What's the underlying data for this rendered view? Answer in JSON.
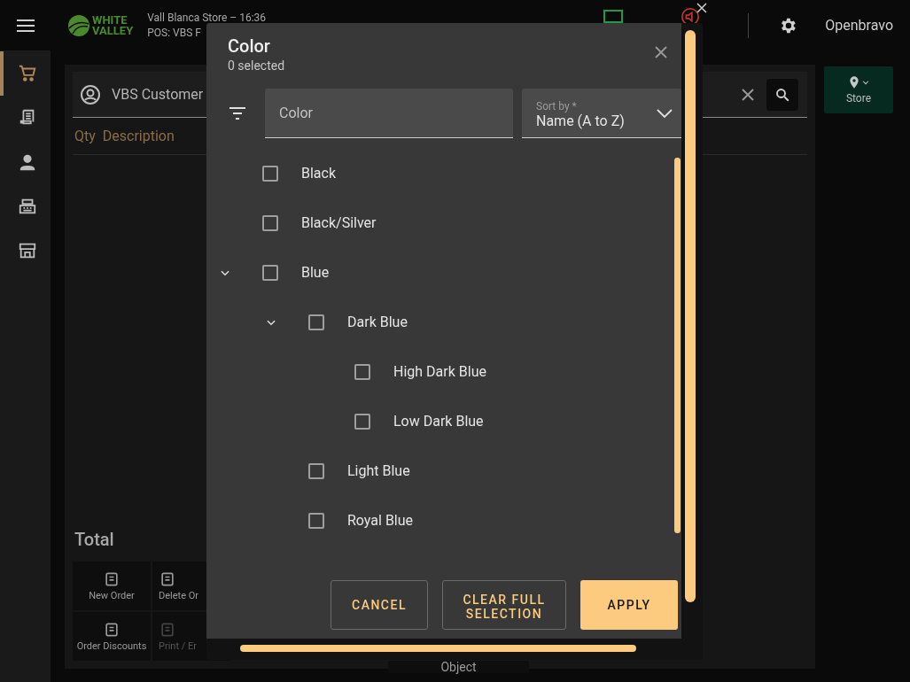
{
  "top_bar": {
    "logo_line_1": "WHITE",
    "logo_line_2": "VALLEY",
    "store_line": "Vall Blanca Store – 16:36",
    "pos_line": "POS: VBS F",
    "user": "Openbravo"
  },
  "nav": [
    {
      "selected": true
    },
    {
      "selected": false
    },
    {
      "selected": false
    },
    {
      "selected": false
    },
    {
      "selected": false
    }
  ],
  "ticket": {
    "customer": "VBS Customer",
    "columns": [
      "Qty",
      "Description"
    ],
    "total_label": "Total",
    "actions": [
      {
        "label": "New Order",
        "disabled": false
      },
      {
        "label": "Delete Or",
        "disabled": false
      },
      {
        "label": "Order Discounts",
        "disabled": false
      },
      {
        "label": "Print / Er",
        "disabled": true
      }
    ],
    "object_label": "Object"
  },
  "store_button": "Store",
  "dialog": {
    "title": "Color",
    "subtitle": "0 selected",
    "filter_placeholder": "Color",
    "sort_label": "Sort by *",
    "sort_value": "Name (A to Z)",
    "items": [
      {
        "label": "Black",
        "checked": false
      },
      {
        "label": "Black/Silver",
        "checked": false
      },
      {
        "label": "Blue",
        "checked": false,
        "expanded": true,
        "children": [
          {
            "label": "Dark Blue",
            "checked": false,
            "expanded": true,
            "children": [
              {
                "label": "High Dark Blue",
                "checked": false
              },
              {
                "label": "Low Dark Blue",
                "checked": false
              }
            ]
          },
          {
            "label": "Light Blue",
            "checked": false
          },
          {
            "label": "Royal Blue",
            "checked": false
          }
        ]
      }
    ],
    "buttons": [
      {
        "label": "CANCEL",
        "kind": "outlined"
      },
      {
        "label": "CLEAR FULL SELECTION",
        "kind": "outlined"
      },
      {
        "label": "APPLY",
        "kind": "filled"
      }
    ]
  }
}
